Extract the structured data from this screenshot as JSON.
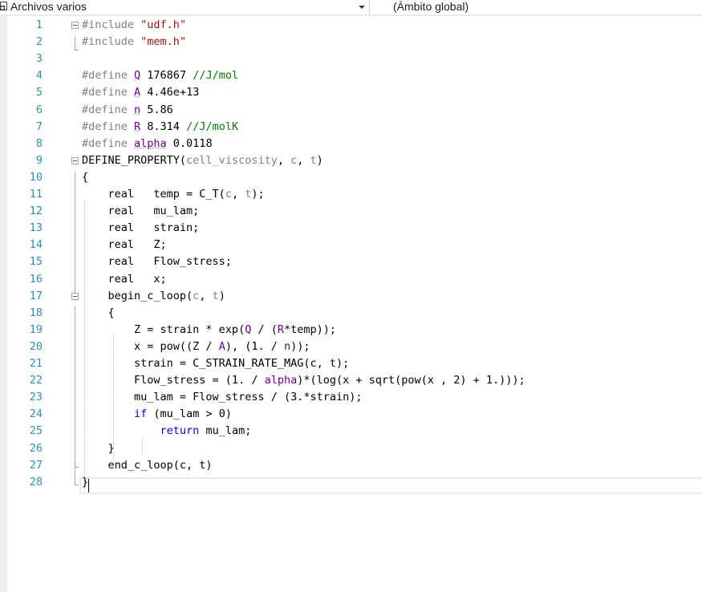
{
  "navigation_bar": {
    "project_dropdown": {
      "label": "Archivos varios"
    },
    "scope_dropdown": {
      "label": "(Ámbito global)"
    }
  },
  "editor": {
    "current_line": 28,
    "lines": [
      {
        "n": "1",
        "fold": "open",
        "tokens": [
          [
            "#include ",
            "pp"
          ],
          [
            "\"udf.h\"",
            "str"
          ]
        ]
      },
      {
        "n": "2",
        "tokens": [
          [
            "#include ",
            "pp"
          ],
          [
            "\"mem.h\"",
            "str"
          ]
        ]
      },
      {
        "n": "3",
        "tokens": []
      },
      {
        "n": "4",
        "tokens": [
          [
            "#define ",
            "pp"
          ],
          [
            "Q",
            "mac-sq"
          ],
          [
            " 176867 ",
            ""
          ],
          [
            "//J/mol",
            "cmt"
          ]
        ]
      },
      {
        "n": "5",
        "tokens": [
          [
            "#define ",
            "pp"
          ],
          [
            "A",
            "mac-sq"
          ],
          [
            " 4.46e+13",
            ""
          ]
        ]
      },
      {
        "n": "6",
        "tokens": [
          [
            "#define ",
            "pp"
          ],
          [
            "n",
            "mac-sq"
          ],
          [
            " 5.86",
            ""
          ]
        ]
      },
      {
        "n": "7",
        "tokens": [
          [
            "#define ",
            "pp"
          ],
          [
            "R",
            "mac-sq"
          ],
          [
            " 8.314 ",
            ""
          ],
          [
            "//J/molK",
            "cmt"
          ]
        ]
      },
      {
        "n": "8",
        "tokens": [
          [
            "#define ",
            "pp"
          ],
          [
            "alpha",
            "mac-sq"
          ],
          [
            " 0.0118",
            ""
          ]
        ]
      },
      {
        "n": "9",
        "fold": "open",
        "tokens": [
          [
            "DEFINE_PROPERTY(",
            ""
          ],
          [
            "cell_viscosity",
            "param"
          ],
          [
            ", ",
            ""
          ],
          [
            "c",
            "param"
          ],
          [
            ", ",
            ""
          ],
          [
            "t",
            "param"
          ],
          [
            ")",
            ""
          ]
        ]
      },
      {
        "n": "10",
        "tokens": [
          [
            "{",
            ""
          ]
        ]
      },
      {
        "n": "11",
        "tokens": [
          [
            "    real   temp = C_T(",
            ""
          ],
          [
            "c",
            "param"
          ],
          [
            ", ",
            ""
          ],
          [
            "t",
            "param"
          ],
          [
            ");",
            ""
          ]
        ]
      },
      {
        "n": "12",
        "tokens": [
          [
            "    real   mu_lam;",
            ""
          ]
        ]
      },
      {
        "n": "13",
        "tokens": [
          [
            "    real   strain;",
            ""
          ]
        ]
      },
      {
        "n": "14",
        "tokens": [
          [
            "    real   Z;",
            ""
          ]
        ]
      },
      {
        "n": "15",
        "tokens": [
          [
            "    real   Flow_stress;",
            ""
          ]
        ]
      },
      {
        "n": "16",
        "tokens": [
          [
            "    real   x;",
            ""
          ]
        ]
      },
      {
        "n": "17",
        "fold": "open",
        "tokens": [
          [
            "    begin_c_loop(",
            ""
          ],
          [
            "c",
            "param"
          ],
          [
            ", ",
            ""
          ],
          [
            "t",
            "param"
          ],
          [
            ")",
            ""
          ]
        ]
      },
      {
        "n": "18",
        "tokens": [
          [
            "    {",
            ""
          ]
        ]
      },
      {
        "n": "19",
        "tokens": [
          [
            "        Z = strain * exp(",
            ""
          ],
          [
            "Q",
            "mac"
          ],
          [
            " / (",
            ""
          ],
          [
            "R",
            "mac"
          ],
          [
            "*temp));",
            ""
          ]
        ]
      },
      {
        "n": "20",
        "tokens": [
          [
            "        x = pow((Z / ",
            ""
          ],
          [
            "A",
            "mac"
          ],
          [
            "), (1. / ",
            ""
          ],
          [
            "n",
            "mac"
          ],
          [
            "));",
            ""
          ]
        ]
      },
      {
        "n": "21",
        "tokens": [
          [
            "        strain = C_STRAIN_RATE_MAG(c, t);",
            ""
          ]
        ]
      },
      {
        "n": "22",
        "tokens": [
          [
            "        Flow_stress = (1. / ",
            ""
          ],
          [
            "alpha",
            "mac"
          ],
          [
            ")*(log(x + sqrt(pow(x , 2) + 1.)));",
            ""
          ]
        ]
      },
      {
        "n": "23",
        "tokens": [
          [
            "        mu_lam = Flow_stress / (3.*strain);",
            ""
          ]
        ]
      },
      {
        "n": "24",
        "tokens": [
          [
            "        ",
            ""
          ],
          [
            "if",
            "kw"
          ],
          [
            " (mu_lam > 0)",
            ""
          ]
        ]
      },
      {
        "n": "25",
        "tokens": [
          [
            "            ",
            ""
          ],
          [
            "return",
            "kw"
          ],
          [
            " mu_lam;",
            ""
          ]
        ]
      },
      {
        "n": "26",
        "tokens": [
          [
            "    }",
            ""
          ]
        ]
      },
      {
        "n": "27",
        "tokens": [
          [
            "    end_c_loop(c, t)",
            ""
          ]
        ]
      },
      {
        "n": "28",
        "tokens": [
          [
            "}",
            ""
          ]
        ]
      }
    ]
  },
  "colors": {
    "line_number": "#2b91af",
    "preprocessor": "#808080",
    "string": "#a31515",
    "macro": "#6f008a",
    "comment": "#008000",
    "keyword": "#0000ff",
    "parameter": "#808080"
  },
  "icons": {
    "project": "project-icon",
    "dropdown": "chevron-down-icon",
    "fold": "collapse-icon"
  }
}
